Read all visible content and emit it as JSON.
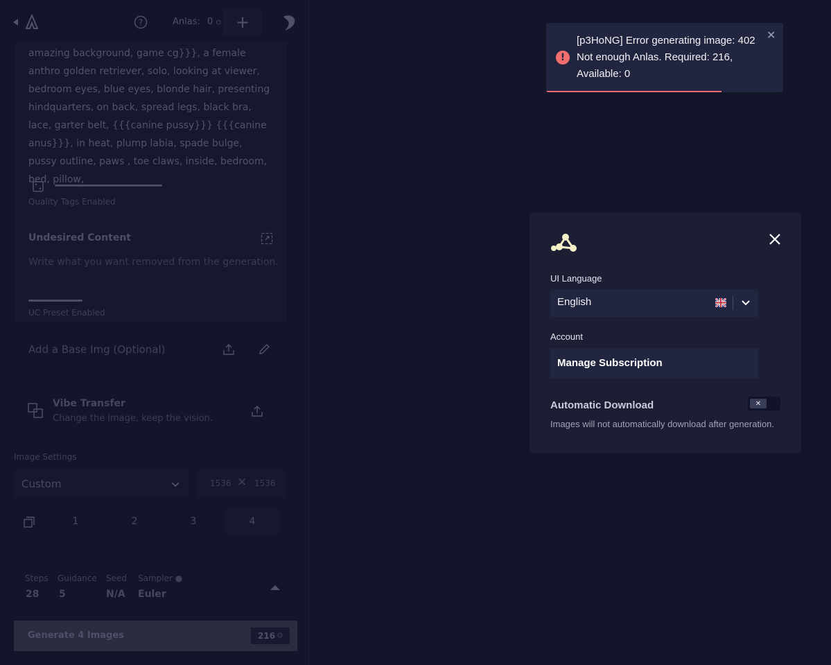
{
  "sidebar": {
    "anlas_label": "Anlas:",
    "anlas_value": "0",
    "prompt_text": "amazing background, game cg}}}, a female anthro golden retriever, solo, looking at viewer, bedroom eyes, blue eyes, blonde hair, presenting hindquarters, on back, spread legs, black bra, lace, garter belt, {{{canine pussy}}} {{{canine anus}}}, in heat, plump labia, spade bulge, pussy outline, paws , toe claws, inside, bedroom, bed, pillow,",
    "quality_tags": "Quality Tags Enabled",
    "undesired_title": "Undesired Content",
    "undesired_placeholder": "Write what you want removed from the generation.",
    "uc_preset": "UC Preset Enabled",
    "base_img": "Add a Base Img (Optional)",
    "vibe_title": "Vibe Transfer",
    "vibe_desc": "Change the image, keep the vision.",
    "image_settings": "Image Settings",
    "size_preset": "Custom",
    "width": "1536",
    "height": "1536",
    "counts": [
      "1",
      "2",
      "3",
      "4"
    ],
    "steps_label": "Steps",
    "steps_value": "28",
    "guidance_label": "Guidance",
    "guidance_value": "5",
    "seed_label": "Seed",
    "seed_value": "N/A",
    "sampler_label": "Sampler ●",
    "sampler_value": "Euler",
    "generate_label": "Generate 4 Images",
    "generate_cost": "216"
  },
  "toast": {
    "message": "[p3HoNG] Error generating image: 402 Not enough Anlas. Required: 216, Available: 0",
    "icon": "exclamation-icon",
    "accent": "#f06e6e",
    "progress": 0.74
  },
  "modal": {
    "ui_language_label": "UI Language",
    "ui_language_value": "English",
    "account_label": "Account",
    "manage_subscription": "Manage Subscription",
    "auto_download_title": "Automatic Download",
    "auto_download_desc": "Images will not automatically download after generation.",
    "auto_download_enabled": false,
    "logo_color": "#f5f0c8"
  }
}
